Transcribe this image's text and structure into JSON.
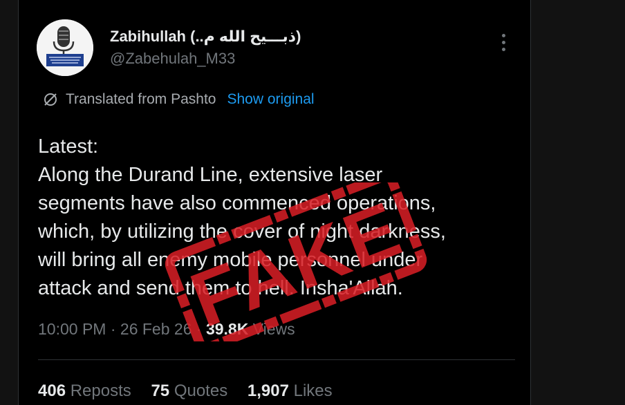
{
  "tweet": {
    "author": {
      "display_name": "Zabihullah (..ذبـــيح الله م)",
      "handle": "@Zabehulah_M33"
    },
    "translation": {
      "label": "Translated from Pashto",
      "show_original": "Show original"
    },
    "text_lines": [
      "Latest:",
      "Along the Durand Line, extensive laser",
      "segments have also commenced operations,",
      "which, by utilizing the cover of night darkness,",
      "will bring all enemy mobile personnel under",
      "attack and send them to hell. Insha'Allah."
    ],
    "meta": {
      "time": "10:00 PM",
      "separator": " · ",
      "date": "26 Feb 26",
      "views_count": "39.8K",
      "views_label": "Views"
    },
    "stats": [
      {
        "count": "406",
        "label": "Reposts"
      },
      {
        "count": "75",
        "label": "Quotes"
      },
      {
        "count": "1,907",
        "label": "Likes"
      }
    ]
  },
  "stamp": {
    "text": "FAKE",
    "color": "#d91f26"
  },
  "icons": {
    "translate": "translate-icon",
    "more": "more-options-icon",
    "avatar": "microphone-logo-avatar"
  },
  "colors": {
    "background": "#000000",
    "text": "#e7e9ea",
    "muted": "#71767b",
    "link": "#1d9bf0"
  }
}
